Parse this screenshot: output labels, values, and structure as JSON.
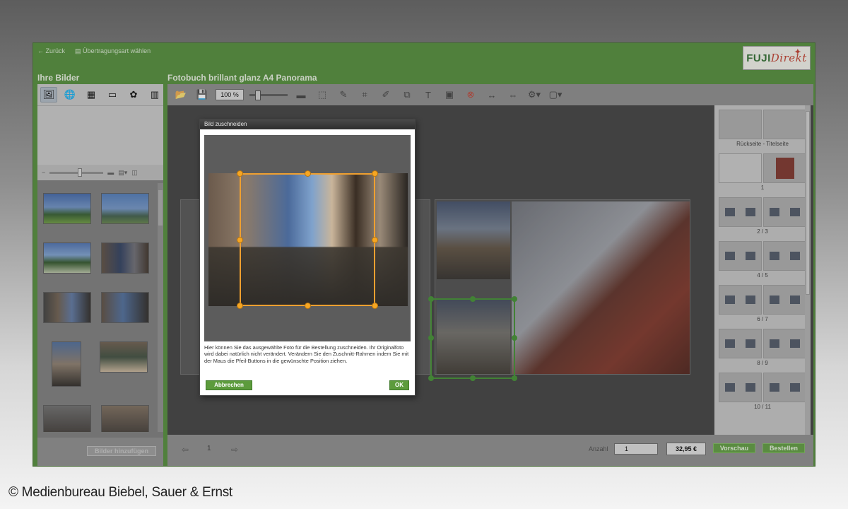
{
  "topbar": {
    "back": "Zurück",
    "transfer": "Übertragungsart wählen"
  },
  "logo": {
    "fuji": "FUJI",
    "direkt": "Direkt"
  },
  "left_panel": {
    "title": "Ihre Bilder",
    "add_button": "Bilder hinzufügen"
  },
  "main": {
    "title": "Fotobuch brillant glanz A4 Panorama",
    "zoom": "100 %"
  },
  "spreads": [
    "Rückseite - Titelseite",
    "1",
    "2 / 3",
    "4 / 5",
    "6 / 7",
    "8 / 9",
    "10 / 11"
  ],
  "dialog": {
    "title": "Bild zuschneiden",
    "text": "Hier können Sie das ausgewählte Foto für die Bestellung zuschneiden. Ihr Originalfoto wird dabei natürlich nicht verändert. Verändern Sie den Zuschnitt-Rahmen indem Sie mit der Maus die Pfeil-Buttons in die gewünschte Position ziehen.",
    "cancel": "Abbrechen",
    "ok": "OK"
  },
  "bottom": {
    "page": "1",
    "anzahl_label": "Anzahl",
    "quantity": "1",
    "price": "32,95 €",
    "preview": "Vorschau",
    "order": "Bestellen"
  },
  "copyright": "© Medienbureau Biebel, Sauer & Ernst",
  "colors": {
    "brand_green": "#4e8b34",
    "crop_orange": "#f5a623",
    "select_green": "#3b8e2b"
  }
}
